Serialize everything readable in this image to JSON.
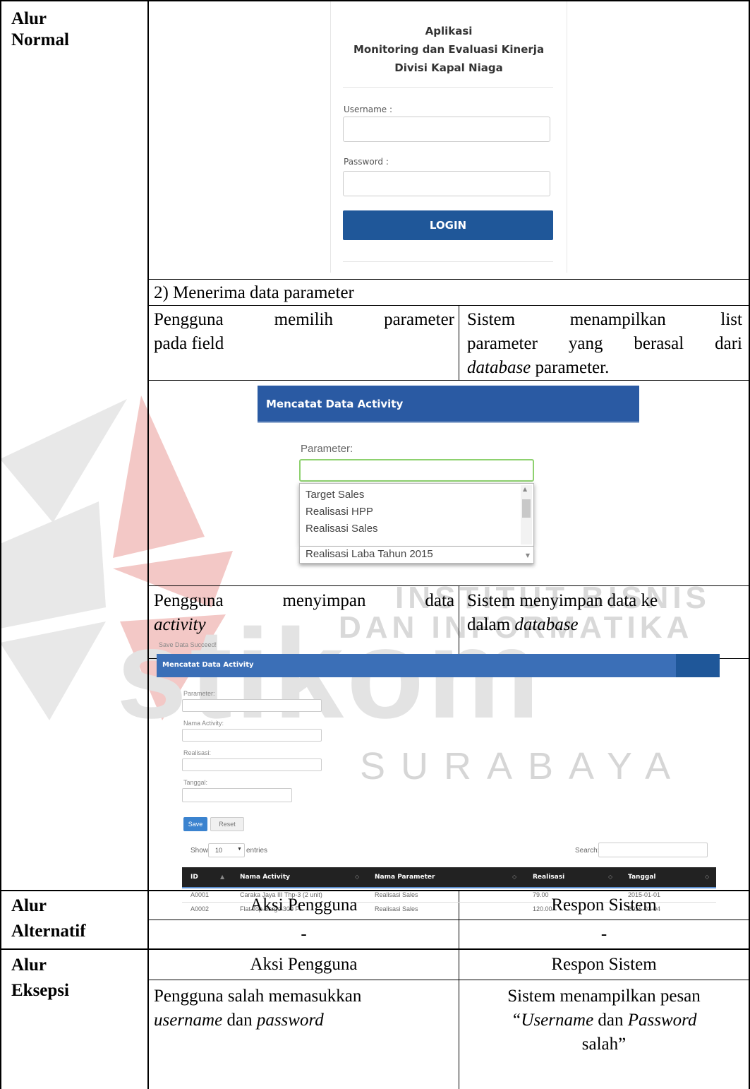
{
  "row_labels": {
    "normal_1": "Alur",
    "normal_2": "Normal",
    "alt_1": "Alur",
    "alt_2": "Alternatif",
    "exc_1": "Alur",
    "exc_2": "Eksepsi"
  },
  "login_screen": {
    "title_1": "Aplikasi",
    "title_2": "Monitoring dan Evaluasi Kinerja",
    "title_3": "Divisi Kapal Niaga",
    "username_label": "Username :",
    "password_label": "Password :",
    "login_button": "LOGIN"
  },
  "step2_heading": "2) Menerima data parameter",
  "step2_user": {
    "line1_words": [
      "Pengguna",
      "memilih",
      "parameter"
    ],
    "line2": "pada field"
  },
  "step2_system": {
    "line1_words": [
      "Sistem",
      "menampilkan",
      "list"
    ],
    "line2_words": [
      "parameter",
      "yang",
      "berasal",
      "dari"
    ],
    "line3_italic": "database",
    "line3_rest": " parameter."
  },
  "param_screen": {
    "header": "Mencatat Data Activity",
    "label": "Parameter:",
    "options": [
      "Target Sales",
      "Realisasi HPP",
      "Realisasi Sales",
      "Realisasi Laba Tahun 2015"
    ]
  },
  "step3_user": {
    "line1_words": [
      "Pengguna",
      "menyimpan",
      "data"
    ],
    "line2_italic": "activity"
  },
  "step3_system": {
    "line1": "Sistem menyimpan data ke",
    "line2_plain": "dalam ",
    "line2_italic": "database"
  },
  "save_screen": {
    "notice": "Save Data Succeed!",
    "header": "Mencatat Data Activity",
    "labels": [
      "Parameter:",
      "Nama Activity:",
      "Realisasi:",
      "Tanggal:"
    ],
    "save_button": "Save",
    "reset_button": "Reset",
    "show_label": "Show",
    "entries_value": "10",
    "entries_label": "entries",
    "search_label": "Search:",
    "columns": [
      "ID",
      "Nama Activity",
      "Nama Parameter",
      "Realisasi",
      "Tanggal"
    ],
    "rows": [
      [
        "A0001",
        "Caraka Jaya III Thp-3 (2 unit)",
        "Realisasi Sales",
        "79.00",
        "2015-01-01"
      ],
      [
        "A0002",
        "Flat Top Barge 300 Ft",
        "Realisasi Sales",
        "120.00",
        "2015-02-04"
      ]
    ]
  },
  "col_heads": {
    "user": "Aksi Pengguna",
    "system": "Respon Sistem"
  },
  "alt_values": {
    "user": "-",
    "system": "-"
  },
  "exception": {
    "user_line1": "Pengguna salah memasukkan",
    "user_line2_italic1": "username",
    "user_line2_mid": " dan ",
    "user_line2_italic2": "password",
    "system_line1": "Sistem menampilkan pesan",
    "system_line2_italic1": "“Username",
    "system_line2_mid": " dan ",
    "system_line2_italic2": "Password",
    "system_line3": "salah”"
  },
  "watermark": {
    "line1": "INSTITUT BISNIS",
    "line2": "DAN INFORMATIKA",
    "brand": "stikom",
    "city": "SURABAYA"
  }
}
